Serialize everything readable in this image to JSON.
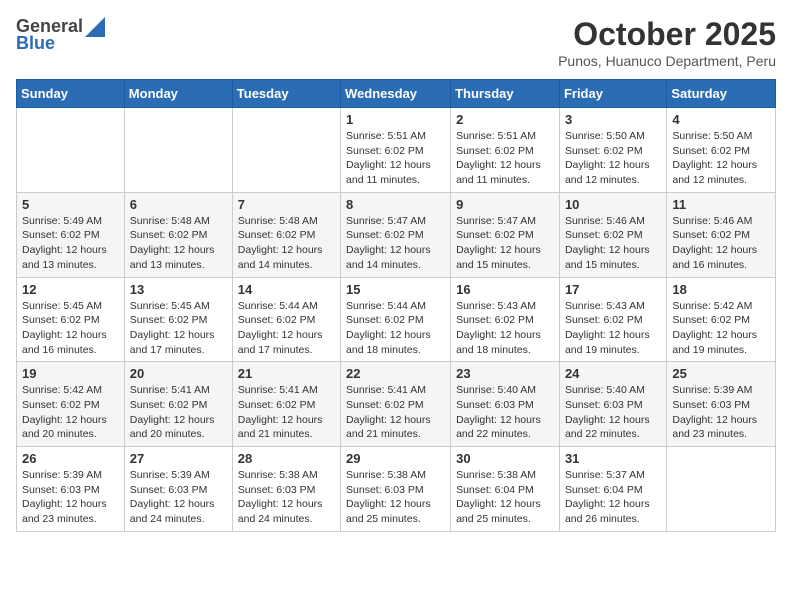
{
  "logo": {
    "general": "General",
    "blue": "Blue"
  },
  "title": "October 2025",
  "subtitle": "Punos, Huanuco Department, Peru",
  "days": [
    "Sunday",
    "Monday",
    "Tuesday",
    "Wednesday",
    "Thursday",
    "Friday",
    "Saturday"
  ],
  "weeks": [
    [
      {
        "date": "",
        "sunrise": "",
        "sunset": "",
        "daylight": ""
      },
      {
        "date": "",
        "sunrise": "",
        "sunset": "",
        "daylight": ""
      },
      {
        "date": "",
        "sunrise": "",
        "sunset": "",
        "daylight": ""
      },
      {
        "date": "1",
        "sunrise": "Sunrise: 5:51 AM",
        "sunset": "Sunset: 6:02 PM",
        "daylight": "Daylight: 12 hours and 11 minutes."
      },
      {
        "date": "2",
        "sunrise": "Sunrise: 5:51 AM",
        "sunset": "Sunset: 6:02 PM",
        "daylight": "Daylight: 12 hours and 11 minutes."
      },
      {
        "date": "3",
        "sunrise": "Sunrise: 5:50 AM",
        "sunset": "Sunset: 6:02 PM",
        "daylight": "Daylight: 12 hours and 12 minutes."
      },
      {
        "date": "4",
        "sunrise": "Sunrise: 5:50 AM",
        "sunset": "Sunset: 6:02 PM",
        "daylight": "Daylight: 12 hours and 12 minutes."
      }
    ],
    [
      {
        "date": "5",
        "sunrise": "Sunrise: 5:49 AM",
        "sunset": "Sunset: 6:02 PM",
        "daylight": "Daylight: 12 hours and 13 minutes."
      },
      {
        "date": "6",
        "sunrise": "Sunrise: 5:48 AM",
        "sunset": "Sunset: 6:02 PM",
        "daylight": "Daylight: 12 hours and 13 minutes."
      },
      {
        "date": "7",
        "sunrise": "Sunrise: 5:48 AM",
        "sunset": "Sunset: 6:02 PM",
        "daylight": "Daylight: 12 hours and 14 minutes."
      },
      {
        "date": "8",
        "sunrise": "Sunrise: 5:47 AM",
        "sunset": "Sunset: 6:02 PM",
        "daylight": "Daylight: 12 hours and 14 minutes."
      },
      {
        "date": "9",
        "sunrise": "Sunrise: 5:47 AM",
        "sunset": "Sunset: 6:02 PM",
        "daylight": "Daylight: 12 hours and 15 minutes."
      },
      {
        "date": "10",
        "sunrise": "Sunrise: 5:46 AM",
        "sunset": "Sunset: 6:02 PM",
        "daylight": "Daylight: 12 hours and 15 minutes."
      },
      {
        "date": "11",
        "sunrise": "Sunrise: 5:46 AM",
        "sunset": "Sunset: 6:02 PM",
        "daylight": "Daylight: 12 hours and 16 minutes."
      }
    ],
    [
      {
        "date": "12",
        "sunrise": "Sunrise: 5:45 AM",
        "sunset": "Sunset: 6:02 PM",
        "daylight": "Daylight: 12 hours and 16 minutes."
      },
      {
        "date": "13",
        "sunrise": "Sunrise: 5:45 AM",
        "sunset": "Sunset: 6:02 PM",
        "daylight": "Daylight: 12 hours and 17 minutes."
      },
      {
        "date": "14",
        "sunrise": "Sunrise: 5:44 AM",
        "sunset": "Sunset: 6:02 PM",
        "daylight": "Daylight: 12 hours and 17 minutes."
      },
      {
        "date": "15",
        "sunrise": "Sunrise: 5:44 AM",
        "sunset": "Sunset: 6:02 PM",
        "daylight": "Daylight: 12 hours and 18 minutes."
      },
      {
        "date": "16",
        "sunrise": "Sunrise: 5:43 AM",
        "sunset": "Sunset: 6:02 PM",
        "daylight": "Daylight: 12 hours and 18 minutes."
      },
      {
        "date": "17",
        "sunrise": "Sunrise: 5:43 AM",
        "sunset": "Sunset: 6:02 PM",
        "daylight": "Daylight: 12 hours and 19 minutes."
      },
      {
        "date": "18",
        "sunrise": "Sunrise: 5:42 AM",
        "sunset": "Sunset: 6:02 PM",
        "daylight": "Daylight: 12 hours and 19 minutes."
      }
    ],
    [
      {
        "date": "19",
        "sunrise": "Sunrise: 5:42 AM",
        "sunset": "Sunset: 6:02 PM",
        "daylight": "Daylight: 12 hours and 20 minutes."
      },
      {
        "date": "20",
        "sunrise": "Sunrise: 5:41 AM",
        "sunset": "Sunset: 6:02 PM",
        "daylight": "Daylight: 12 hours and 20 minutes."
      },
      {
        "date": "21",
        "sunrise": "Sunrise: 5:41 AM",
        "sunset": "Sunset: 6:02 PM",
        "daylight": "Daylight: 12 hours and 21 minutes."
      },
      {
        "date": "22",
        "sunrise": "Sunrise: 5:41 AM",
        "sunset": "Sunset: 6:02 PM",
        "daylight": "Daylight: 12 hours and 21 minutes."
      },
      {
        "date": "23",
        "sunrise": "Sunrise: 5:40 AM",
        "sunset": "Sunset: 6:03 PM",
        "daylight": "Daylight: 12 hours and 22 minutes."
      },
      {
        "date": "24",
        "sunrise": "Sunrise: 5:40 AM",
        "sunset": "Sunset: 6:03 PM",
        "daylight": "Daylight: 12 hours and 22 minutes."
      },
      {
        "date": "25",
        "sunrise": "Sunrise: 5:39 AM",
        "sunset": "Sunset: 6:03 PM",
        "daylight": "Daylight: 12 hours and 23 minutes."
      }
    ],
    [
      {
        "date": "26",
        "sunrise": "Sunrise: 5:39 AM",
        "sunset": "Sunset: 6:03 PM",
        "daylight": "Daylight: 12 hours and 23 minutes."
      },
      {
        "date": "27",
        "sunrise": "Sunrise: 5:39 AM",
        "sunset": "Sunset: 6:03 PM",
        "daylight": "Daylight: 12 hours and 24 minutes."
      },
      {
        "date": "28",
        "sunrise": "Sunrise: 5:38 AM",
        "sunset": "Sunset: 6:03 PM",
        "daylight": "Daylight: 12 hours and 24 minutes."
      },
      {
        "date": "29",
        "sunrise": "Sunrise: 5:38 AM",
        "sunset": "Sunset: 6:03 PM",
        "daylight": "Daylight: 12 hours and 25 minutes."
      },
      {
        "date": "30",
        "sunrise": "Sunrise: 5:38 AM",
        "sunset": "Sunset: 6:04 PM",
        "daylight": "Daylight: 12 hours and 25 minutes."
      },
      {
        "date": "31",
        "sunrise": "Sunrise: 5:37 AM",
        "sunset": "Sunset: 6:04 PM",
        "daylight": "Daylight: 12 hours and 26 minutes."
      },
      {
        "date": "",
        "sunrise": "",
        "sunset": "",
        "daylight": ""
      }
    ]
  ]
}
